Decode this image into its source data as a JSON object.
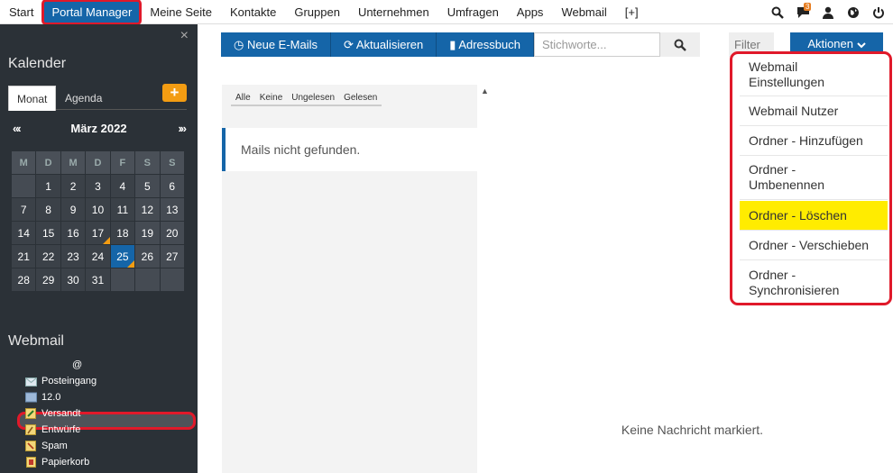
{
  "topnav": {
    "items": [
      "Start",
      "Portal Manager",
      "Meine Seite",
      "Kontakte",
      "Gruppen",
      "Unternehmen",
      "Umfragen",
      "Apps",
      "Webmail",
      "[+]"
    ],
    "chat_badge": "3"
  },
  "sidebar": {
    "close": "×",
    "calendar_title": "Kalender",
    "tab_month": "Monat",
    "tab_agenda": "Agenda",
    "add": "+",
    "prev": "«‹",
    "month_label": "März 2022",
    "next": "›»",
    "weekdays": [
      "M",
      "D",
      "M",
      "D",
      "F",
      "S",
      "S"
    ],
    "weeks": [
      [
        "",
        "1",
        "2",
        "3",
        "4",
        "5",
        "6"
      ],
      [
        "7",
        "8",
        "9",
        "10",
        "11",
        "12",
        "13"
      ],
      [
        "14",
        "15",
        "16",
        "17",
        "18",
        "19",
        "20"
      ],
      [
        "21",
        "22",
        "23",
        "24",
        "25",
        "26",
        "27"
      ],
      [
        "28",
        "29",
        "30",
        "31",
        "",
        "",
        ""
      ]
    ],
    "webmail_title": "Webmail",
    "root_label": "@",
    "folders": [
      "Posteingang",
      "12.0",
      "Versandt",
      "Entwürfe",
      "Spam",
      "Papierkorb"
    ]
  },
  "toolbar": {
    "new_mails": "Neue E-Mails",
    "refresh": "Aktualisieren",
    "addressbook": "Adressbuch",
    "search_placeholder": "Stichworte...",
    "filter": "Filter",
    "actions": "Aktionen"
  },
  "list": {
    "filters": [
      "Alle",
      "Keine",
      "Ungelesen",
      "Gelesen"
    ],
    "empty": "Mails nicht gefunden."
  },
  "preview": {
    "none": "Keine Nachricht markiert."
  },
  "dropdown": {
    "items": [
      {
        "l1": "Webmail",
        "l2": "Einstellungen"
      },
      {
        "l1": "Webmail Nutzer",
        "l2": ""
      },
      {
        "l1": "Ordner - Hinzufügen",
        "l2": ""
      },
      {
        "l1": "Ordner -",
        "l2": "Umbenennen"
      },
      {
        "l1": "Ordner - Löschen",
        "l2": ""
      },
      {
        "l1": "Ordner - Verschieben",
        "l2": ""
      },
      {
        "l1": "Ordner -",
        "l2": "Synchronisieren"
      }
    ]
  },
  "colors": {
    "accent": "#1565a8",
    "highlight": "#ffec00",
    "annotation": "#e0192a",
    "badge": "#e67e22"
  }
}
